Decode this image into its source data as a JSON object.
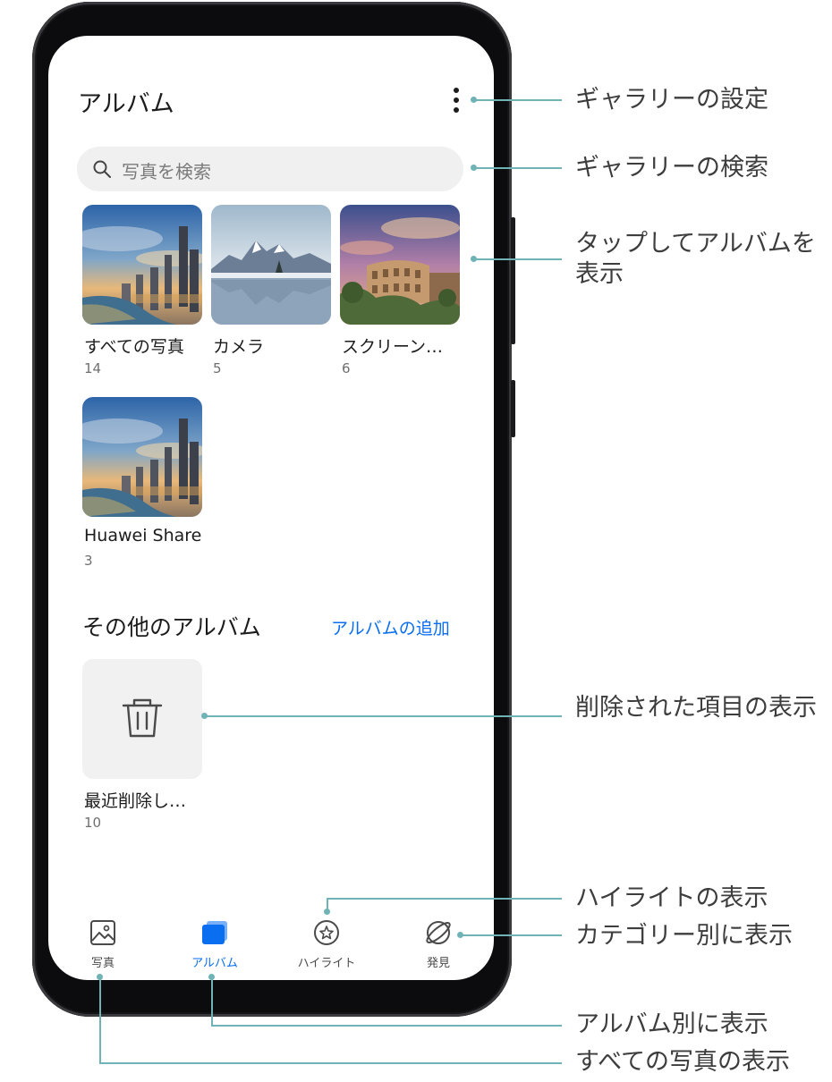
{
  "header": {
    "title": "アルバム",
    "more_icon": "more-vertical-icon"
  },
  "search": {
    "placeholder": "写真を検索",
    "icon": "search-icon"
  },
  "albums": [
    {
      "name": "すべての写真",
      "count": "14",
      "image": "city-skyline-photo"
    },
    {
      "name": "カメラ",
      "count": "5",
      "image": "mountain-lake-photo"
    },
    {
      "name": "スクリーン…",
      "count": "6",
      "image": "colosseum-photo"
    },
    {
      "name": "Huawei Share",
      "count": "3",
      "image": "city-skyline-photo"
    }
  ],
  "other_albums": {
    "title": "その他のアルバム",
    "add_label": "アルバムの追加",
    "items": [
      {
        "name": "最近削除し…",
        "count": "10",
        "icon": "trash-icon"
      }
    ]
  },
  "bottom_nav": [
    {
      "label": "写真",
      "icon": "image-icon",
      "active": false
    },
    {
      "label": "アルバム",
      "icon": "albums-icon",
      "active": true
    },
    {
      "label": "ハイライト",
      "icon": "star-circle-icon",
      "active": false
    },
    {
      "label": "発見",
      "icon": "discover-icon",
      "active": false
    }
  ],
  "callouts": {
    "settings": "ギャラリーの設定",
    "search": "ギャラリーの検索",
    "open_album": "タップしてアルバムを表示",
    "deleted": "削除された項目の表示",
    "highlights": "ハイライトの表示",
    "category": "カテゴリー別に表示",
    "by_album": "アルバム別に表示",
    "all_photos": "すべての写真の表示"
  },
  "colors": {
    "accent": "#0a6ef0",
    "callout": "#6fb3b7",
    "phone_body": "#0c0c0e"
  }
}
